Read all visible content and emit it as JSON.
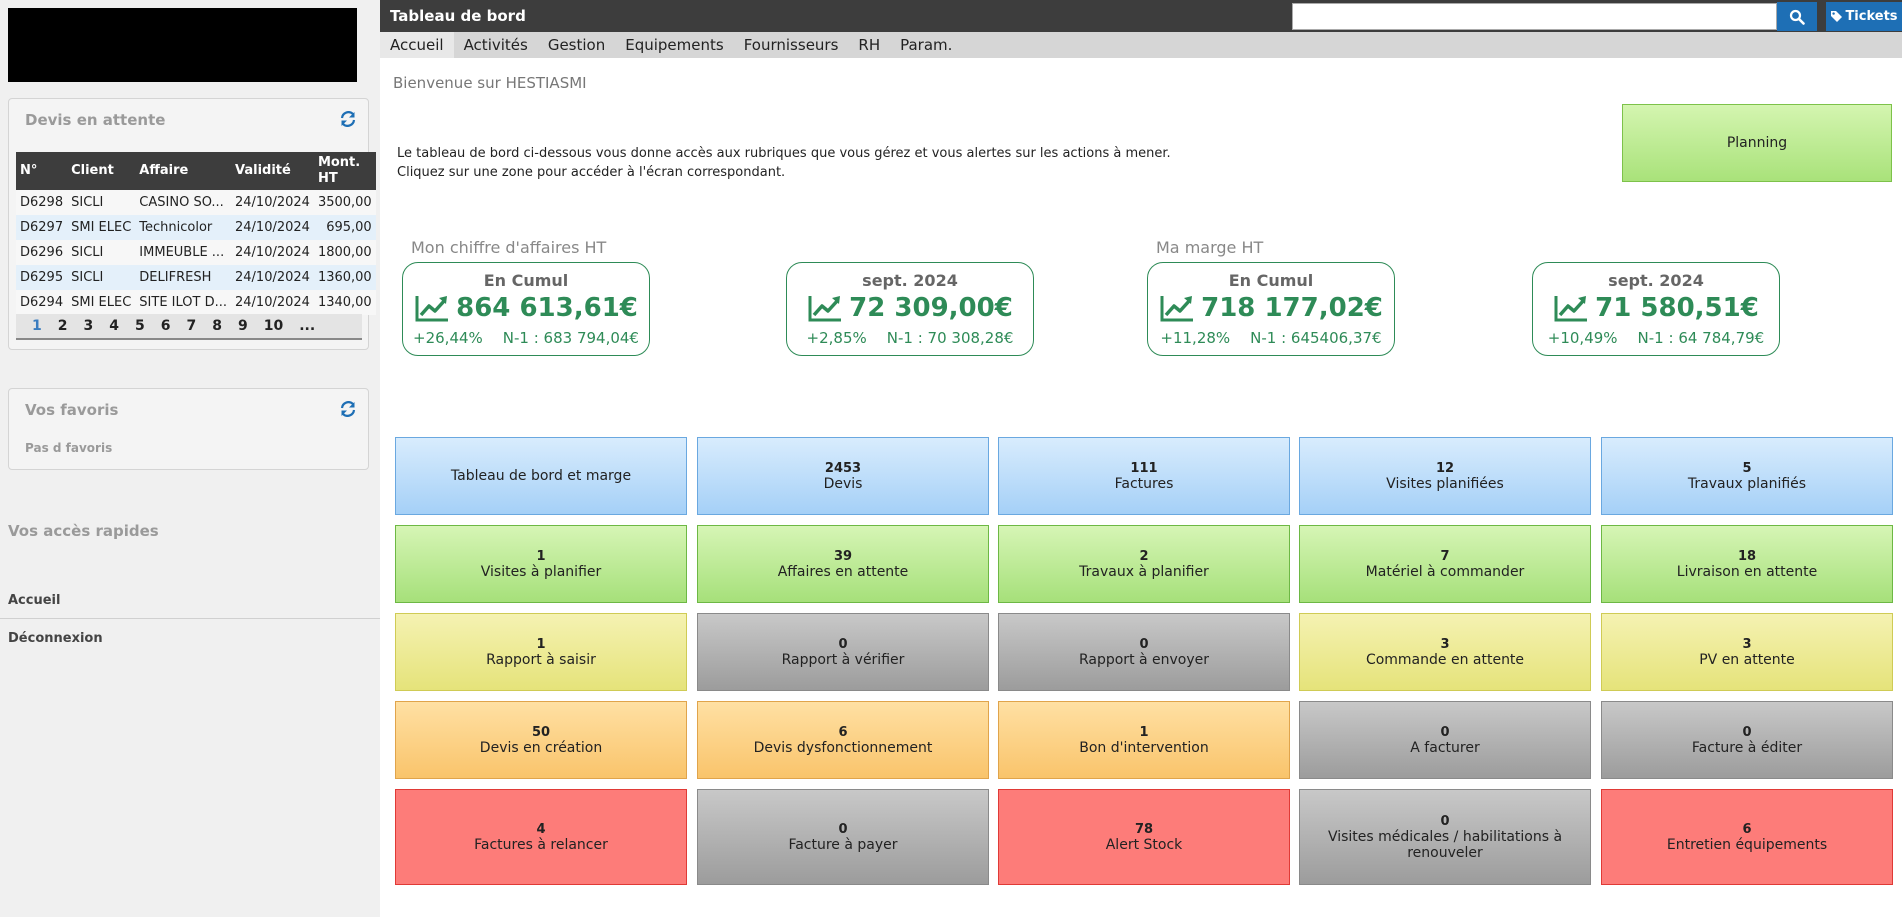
{
  "header": {
    "title": "Tableau de bord",
    "search_placeholder": "",
    "tickets_label": "Tickets"
  },
  "menu": [
    "Accueil",
    "Activités",
    "Gestion",
    "Equipements",
    "Fournisseurs",
    "RH",
    "Param."
  ],
  "sidebar": {
    "devis_title": "Devis en attente",
    "devis_columns": [
      "N°",
      "Client",
      "Affaire",
      "Validité",
      "Mont. HT"
    ],
    "devis_rows": [
      [
        "D6298",
        "SICLI",
        "CASINO SO...",
        "24/10/2024",
        "3500,00"
      ],
      [
        "D6297",
        "SMI ELEC",
        "Technicolor",
        "24/10/2024",
        "695,00"
      ],
      [
        "D6296",
        "SICLI",
        "IMMEUBLE ...",
        "24/10/2024",
        "1800,00"
      ],
      [
        "D6295",
        "SICLI",
        "DELIFRESH",
        "24/10/2024",
        "1360,00"
      ],
      [
        "D6294",
        "SMI ELEC",
        "SITE ILOT D...",
        "24/10/2024",
        "1340,00"
      ]
    ],
    "pager": [
      "1",
      "2",
      "3",
      "4",
      "5",
      "6",
      "7",
      "8",
      "9",
      "10",
      "..."
    ],
    "favoris_title": "Vos favoris",
    "favoris_empty": "Pas d favoris",
    "acces_title": "Vos accès rapides",
    "links": [
      "Accueil",
      "Déconnexion"
    ]
  },
  "main": {
    "welcome": "Bienvenue sur HESTIASMI",
    "intro": "Le tableau de bord ci-dessous vous donne accès aux rubriques que vous gérez et vous alertes sur les actions à mener. Cliquez sur une zone pour accéder à l'écran correspondant.",
    "planning_label": "Planning",
    "kpi_labels": [
      "Mon chiffre d'affaires HT",
      "Ma marge HT"
    ],
    "kpis": [
      {
        "period": "En Cumul",
        "value": "864 613,61€",
        "change": "+26,44%",
        "previous": "N-1 : 683 794,04€"
      },
      {
        "period": "sept. 2024",
        "value": "72 309,00€",
        "change": "+2,85%",
        "previous": "N-1 : 70 308,28€"
      },
      {
        "period": "En Cumul",
        "value": "718 177,02€",
        "change": "+11,28%",
        "previous": "N-1 : 645406,37€"
      },
      {
        "period": "sept. 2024",
        "value": "71 580,51€",
        "change": "+10,49%",
        "previous": "N-1 : 64 784,79€"
      }
    ],
    "tiles": [
      {
        "count": "",
        "label": "Tableau de bord et marge",
        "color": "blue"
      },
      {
        "count": "2453",
        "label": "Devis",
        "color": "blue"
      },
      {
        "count": "111",
        "label": "Factures",
        "color": "blue"
      },
      {
        "count": "12",
        "label": "Visites planifiées",
        "color": "blue"
      },
      {
        "count": "5",
        "label": "Travaux planifiés",
        "color": "blue"
      },
      {
        "count": "1",
        "label": "Visites à planifier",
        "color": "green"
      },
      {
        "count": "39",
        "label": "Affaires en attente",
        "color": "green"
      },
      {
        "count": "2",
        "label": "Travaux à planifier",
        "color": "green"
      },
      {
        "count": "7",
        "label": "Matériel à commander",
        "color": "green"
      },
      {
        "count": "18",
        "label": "Livraison en attente",
        "color": "green"
      },
      {
        "count": "1",
        "label": "Rapport à saisir",
        "color": "yellow"
      },
      {
        "count": "0",
        "label": "Rapport à vérifier",
        "color": "grey"
      },
      {
        "count": "0",
        "label": "Rapport à envoyer",
        "color": "grey"
      },
      {
        "count": "3",
        "label": "Commande en attente",
        "color": "yellow"
      },
      {
        "count": "3",
        "label": "PV en attente",
        "color": "yellow"
      },
      {
        "count": "50",
        "label": "Devis en création",
        "color": "orange"
      },
      {
        "count": "6",
        "label": "Devis dysfonctionnement",
        "color": "orange"
      },
      {
        "count": "1",
        "label": "Bon d'intervention",
        "color": "orange"
      },
      {
        "count": "0",
        "label": "A facturer",
        "color": "grey"
      },
      {
        "count": "0",
        "label": "Facture à éditer",
        "color": "grey"
      },
      {
        "count": "4",
        "label": "Factures à relancer",
        "color": "red"
      },
      {
        "count": "0",
        "label": "Facture à payer",
        "color": "grey"
      },
      {
        "count": "78",
        "label": "Alert Stock",
        "color": "red"
      },
      {
        "count": "0",
        "label": "Visites médicales / habilitations à renouveler",
        "color": "grey"
      },
      {
        "count": "6",
        "label": "Entretien équipements",
        "color": "red"
      }
    ]
  },
  "colors": {
    "topbar": "#3d3d3d",
    "accent_blue": "#1e6fb5",
    "kpi_green": "#2e8b57"
  }
}
